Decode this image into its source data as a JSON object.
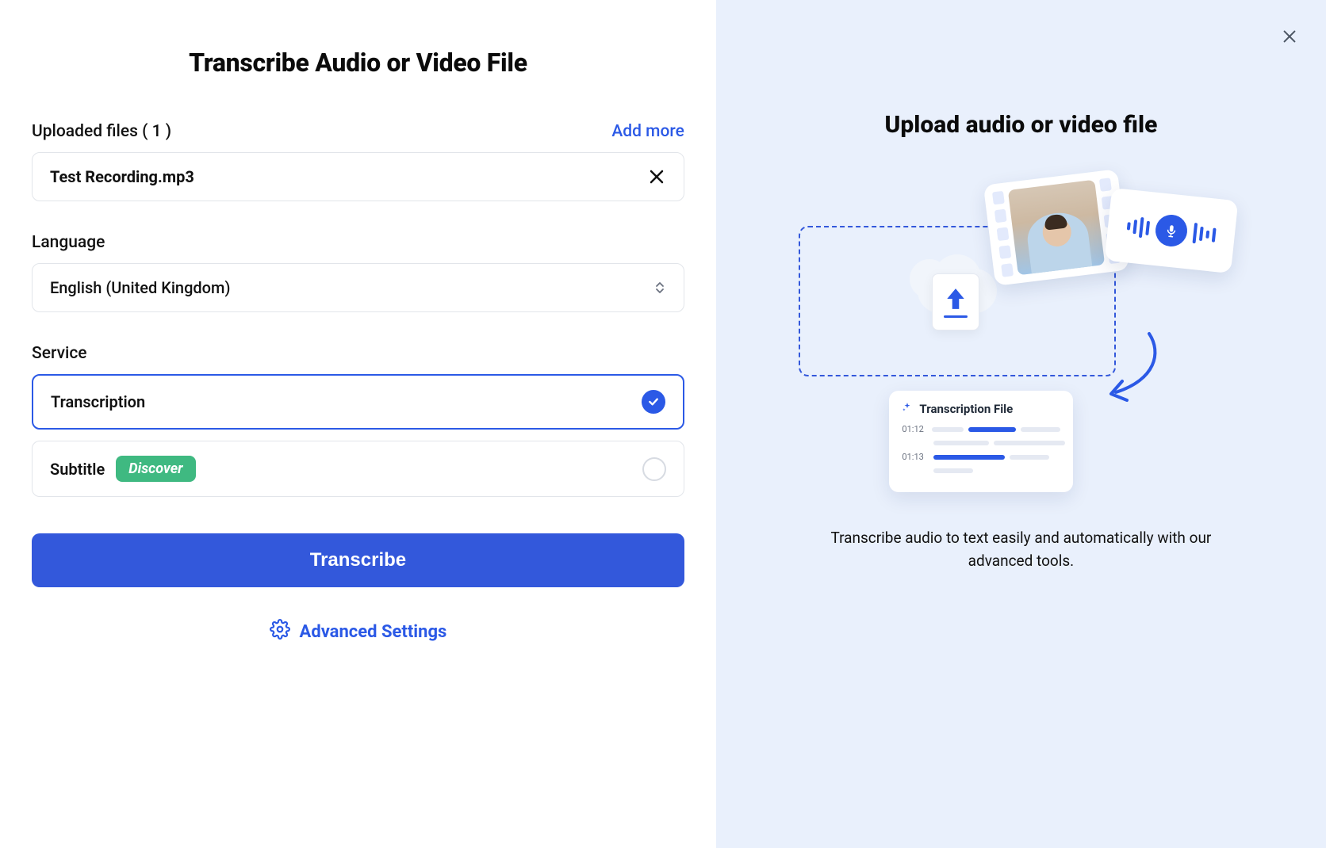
{
  "left": {
    "title": "Transcribe Audio or Video File",
    "uploaded_label": "Uploaded files ( 1 )",
    "add_more": "Add more",
    "file_name": "Test Recording.mp3",
    "language_label": "Language",
    "language_value": "English (United Kingdom)",
    "service_label": "Service",
    "service_options": {
      "transcription": "Transcription",
      "subtitle": "Subtitle",
      "discover_badge": "Discover"
    },
    "primary_button": "Transcribe",
    "advanced_settings": "Advanced Settings"
  },
  "right": {
    "title": "Upload audio or video file",
    "transcript_card_title": "Transcription File",
    "timecode1": "01:12",
    "timecode2": "01:13",
    "description": "Transcribe audio to text easily and automatically with our advanced tools."
  }
}
